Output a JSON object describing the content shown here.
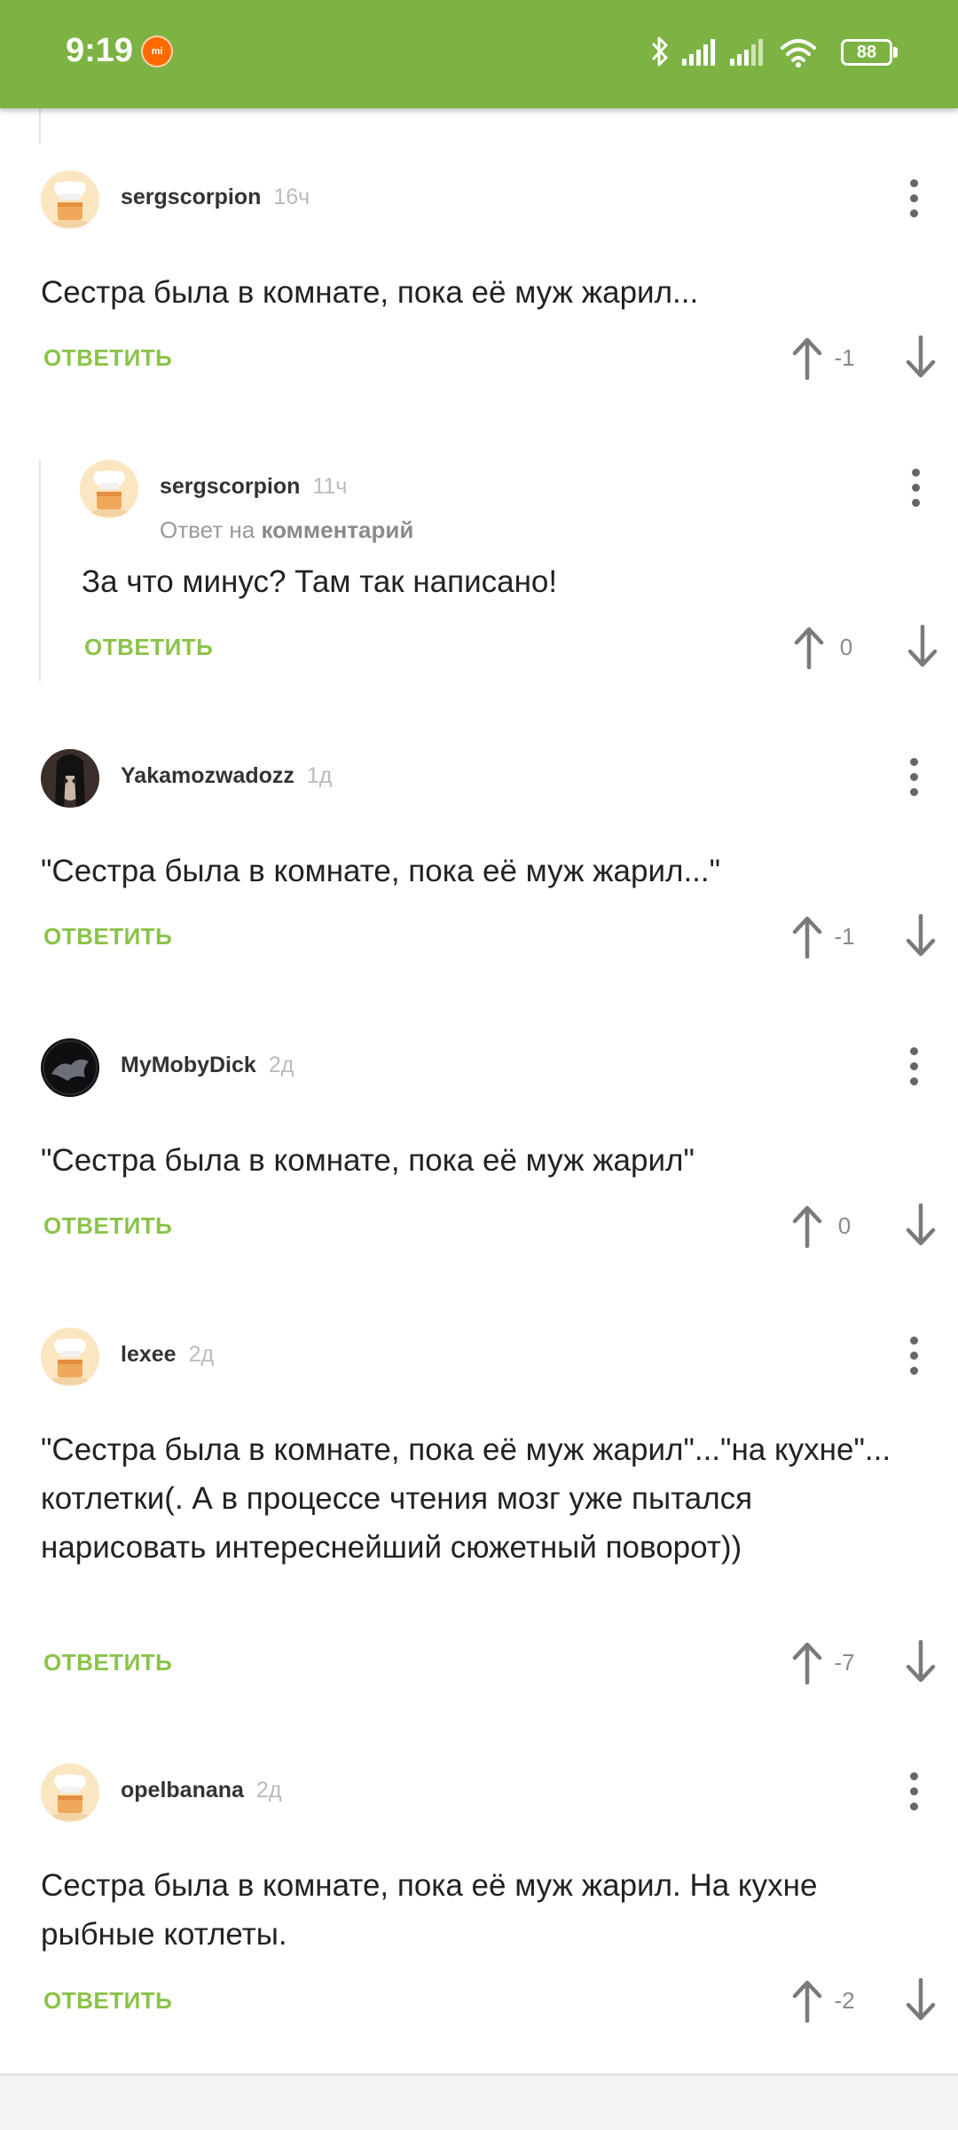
{
  "status_bar": {
    "time": "9:19",
    "mi_label": "mi",
    "battery": "88",
    "bg_color": "#7cb342"
  },
  "comments": [
    {
      "user": "sergscorpion",
      "time": "16ч",
      "reply_prefix": "",
      "reply_target": "",
      "text": "Сестра была в комнате, пока её муж жарил...",
      "answer_label": "ОТВЕТИТЬ",
      "score": "-1"
    },
    {
      "user": "sergscorpion",
      "time": "11ч",
      "reply_prefix": "Ответ на",
      "reply_target": "комментарий",
      "text": "За что минус? Там так написано!",
      "answer_label": "ОТВЕТИТЬ",
      "score": "0"
    },
    {
      "user": "Yakamozwadozz",
      "time": "1д",
      "reply_prefix": "",
      "reply_target": "",
      "text": "\"Сестра была в комнате, пока её муж жарил...\"",
      "answer_label": "ОТВЕТИТЬ",
      "score": "-1"
    },
    {
      "user": "MyMobyDick",
      "time": "2д",
      "reply_prefix": "",
      "reply_target": "",
      "text": "\"Сестра была в комнате, пока её муж жарил\"",
      "answer_label": "ОТВЕТИТЬ",
      "score": "0"
    },
    {
      "user": "lexee",
      "time": "2д",
      "reply_prefix": "",
      "reply_target": "",
      "text": "\"Сестра была в комнате, пока её муж жарил\"...\"на кухне\"... котлетки(. А в процессе чтения мозг уже пытался нарисовать интереснейший сюжетный поворот))",
      "answer_label": "ОТВЕТИТЬ",
      "score": "-7"
    },
    {
      "user": "opelbanana",
      "time": "2д",
      "reply_prefix": "",
      "reply_target": "",
      "text": "Сестра была в комнате, пока её муж жарил. На кухне рыбные котлеты.",
      "answer_label": "ОТВЕТИТЬ",
      "score": "-2"
    }
  ],
  "colors": {
    "answer": "#8bc34a",
    "score": "#8a8a8a",
    "thread_line": "#e4e4e4"
  },
  "icons": {
    "avatar_default": "chef-hat-avatar-icon",
    "vote_up": "arrow-up-icon",
    "vote_down": "arrow-down-icon",
    "more": "more-vertical-icon"
  }
}
